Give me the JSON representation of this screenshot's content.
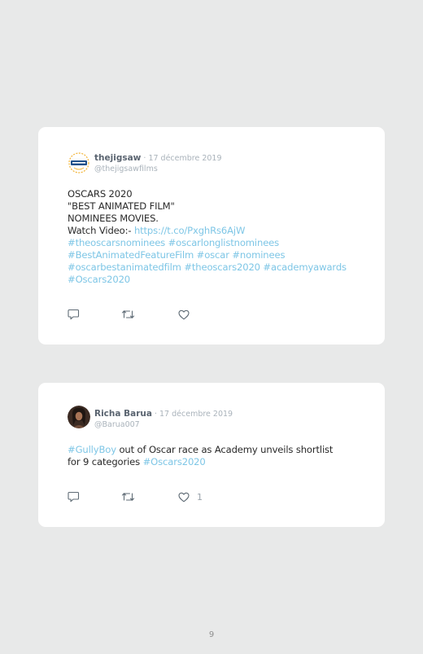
{
  "tweets": [
    {
      "author_name": "thejigsaw",
      "date": "17 décembre 2019",
      "handle": "@thejigsawfilms",
      "avatar_icon": "thejigsaw-logo-icon",
      "lines": [
        [
          {
            "t": "OSCARS 2020",
            "link": false
          }
        ],
        [
          {
            "t": "\"BEST ANIMATED FILM\"",
            "link": false
          }
        ],
        [
          {
            "t": "NOMINEES MOVIES.",
            "link": false
          }
        ],
        [
          {
            "t": "Watch Video:- ",
            "link": false
          },
          {
            "t": "https://t.co/PxghRs6AjW",
            "link": true
          }
        ],
        [
          {
            "t": "#theoscarsnominees #oscarlonglistnominees",
            "link": true
          }
        ],
        [
          {
            "t": "#BestAnimatedFeatureFilm #oscar #nominees",
            "link": true
          }
        ],
        [
          {
            "t": "#oscarbestanimatedfilm #theoscars2020 #academyawards",
            "link": true
          }
        ],
        [
          {
            "t": "#Oscars2020",
            "link": true
          }
        ]
      ],
      "like_count": ""
    },
    {
      "author_name": "Richa Barua",
      "date": "17 décembre 2019",
      "handle": "@Barua007",
      "avatar_icon": "user-photo-icon",
      "lines": [
        [
          {
            "t": "#GullyBoy",
            "link": true
          },
          {
            "t": " out of Oscar race as Academy unveils shortlist",
            "link": false
          }
        ],
        [
          {
            "t": "for 9 categories ",
            "link": false
          },
          {
            "t": "#Oscars2020",
            "link": true
          }
        ]
      ],
      "like_count": "1"
    }
  ],
  "colors": {
    "link": "#7ec6e6",
    "background": "#e8e9e9",
    "card": "#ffffff"
  },
  "page_number": "9"
}
